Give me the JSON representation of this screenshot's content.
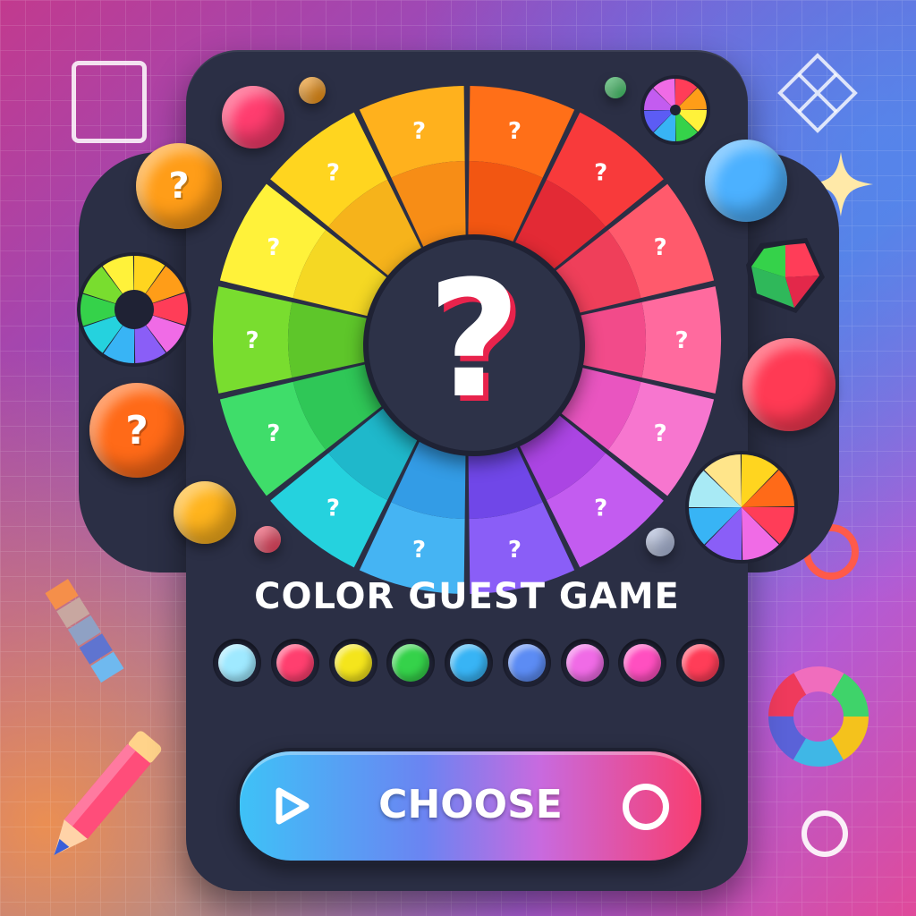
{
  "game": {
    "title": "COLOR GUEST GAME",
    "center_symbol": "?",
    "choose_label": "CHOOSE"
  },
  "wheel": {
    "segment_symbol": "?",
    "segments": [
      {
        "outer": "#ff6f18",
        "inner": "#f25612"
      },
      {
        "outer": "#f83a3b",
        "inner": "#e32a35"
      },
      {
        "outer": "#ff5a6c",
        "inner": "#ef3f5a"
      },
      {
        "outer": "#ff6a9e",
        "inner": "#f24b8a"
      },
      {
        "outer": "#f776cf",
        "inner": "#e955c0"
      },
      {
        "outer": "#c35cf0",
        "inner": "#ab45e3"
      },
      {
        "outer": "#8a5ef7",
        "inner": "#7047e8"
      },
      {
        "outer": "#45b4f3",
        "inner": "#339ce6"
      },
      {
        "outer": "#25d2de",
        "inner": "#1fb8cb"
      },
      {
        "outer": "#3fdd6a",
        "inner": "#2fc757"
      },
      {
        "outer": "#79dd2f",
        "inner": "#5ec62a"
      },
      {
        "outer": "#fff23a",
        "inner": "#f5d823"
      },
      {
        "outer": "#ffd51f",
        "inner": "#f6b31b"
      },
      {
        "outer": "#ffb11d",
        "inner": "#f78d16"
      }
    ]
  },
  "swatches": [
    "#9fe9ff",
    "#ff3f6f",
    "#f4e51c",
    "#35d24a",
    "#38b4f5",
    "#5c8cf4",
    "#f06be6",
    "#ff4fc0",
    "#ff3d58"
  ],
  "side_orbs": [
    {
      "symbol": "?",
      "color": "#ff9d18"
    },
    {
      "symbol": "?",
      "color": "#ff6a18"
    },
    {
      "symbol": "",
      "color": "#ff3d6f"
    },
    {
      "symbol": "",
      "color": "#4cb1ff"
    },
    {
      "symbol": "",
      "color": "#ff3a54"
    },
    {
      "symbol": "",
      "color": "#ffb41d"
    }
  ]
}
